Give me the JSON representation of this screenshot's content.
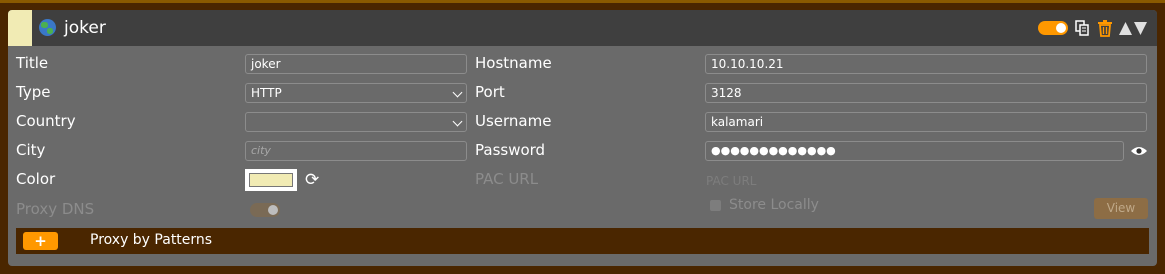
{
  "header": {
    "title": "joker",
    "active": true,
    "icons": [
      "globe-icon",
      "duplicate-icon",
      "trash-icon",
      "move-up-icon",
      "move-down-icon"
    ],
    "swatch_color": "#f1ebb4"
  },
  "fields": {
    "title_label": "Title",
    "title_value": "joker",
    "type_label": "Type",
    "type_value": "HTTP",
    "country_label": "Country",
    "country_value": "",
    "city_label": "City",
    "city_placeholder": "city",
    "color_label": "Color",
    "color_value": "#f1ebb4",
    "proxy_dns_label": "Proxy DNS",
    "proxy_dns_enabled": true,
    "hostname_label": "Hostname",
    "hostname_value": "10.10.10.21",
    "port_label": "Port",
    "port_value": "3128",
    "username_label": "Username",
    "username_value": "kalamari",
    "password_label": "Password",
    "password_value": "●●●●●●●●●●●●●",
    "pac_url_label": "PAC URL",
    "pac_url_placeholder": "PAC URL",
    "store_locally_label": "Store Locally",
    "view_button": "View"
  },
  "footer": {
    "add_button": "+",
    "patterns_label": "Proxy by Patterns"
  },
  "colors": {
    "accent": "#ff9800",
    "card_bg": "#6a6a6a",
    "header_bg": "#3f3f3f",
    "footer_bg": "#4a2600"
  }
}
